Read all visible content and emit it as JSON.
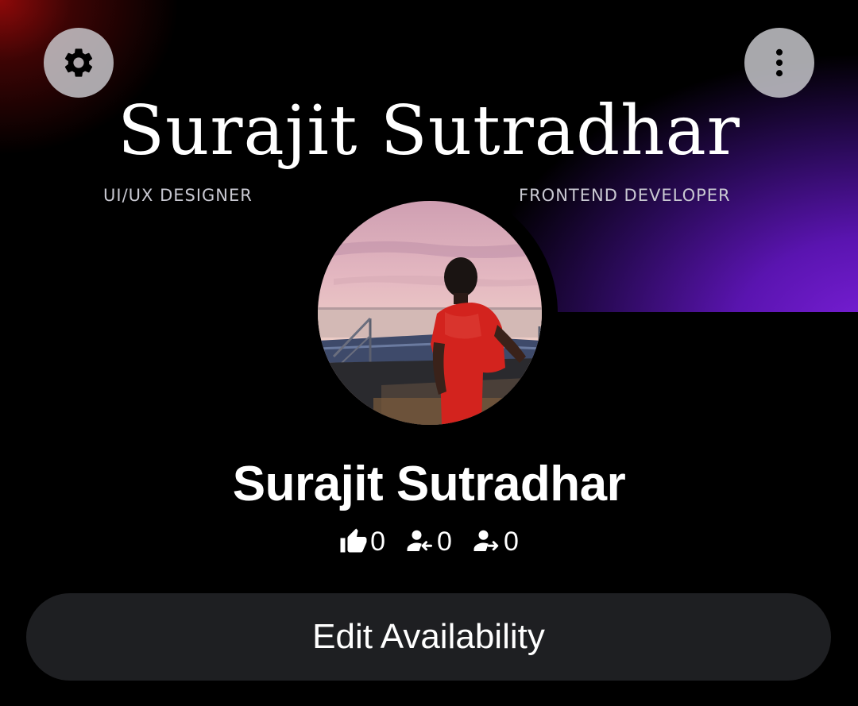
{
  "banner": {
    "title": "Surajit Sutradhar",
    "subtitle_left": "UI/UX DESIGNER",
    "subtitle_right": "FRONTEND DEVELOPER"
  },
  "header": {
    "left_icon": "gear-icon",
    "right_icon": "more-vertical-icon"
  },
  "profile": {
    "name": "Surajit Sutradhar",
    "stats": [
      {
        "icon": "thumbs-up-icon",
        "value": "0"
      },
      {
        "icon": "user-incoming-icon",
        "value": "0"
      },
      {
        "icon": "user-outgoing-icon",
        "value": "0"
      }
    ]
  },
  "actions": {
    "edit_label": "Edit Availability"
  },
  "colors": {
    "background": "#000000",
    "banner_accent": "#7a1fd8",
    "banner_red": "#960a0a",
    "button_bg": "#1e1f22",
    "icon_button_bg": "#cdcdd2"
  }
}
